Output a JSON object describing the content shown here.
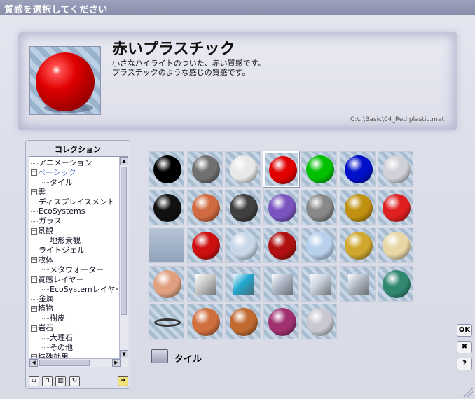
{
  "window": {
    "title": "質感を選択してください"
  },
  "material": {
    "name": "赤いプラスチック",
    "description_line1": "小さなハイライトのついた、赤い質感です。",
    "description_line2": "プラスチックのような感じの質感です。",
    "path": "C:\\..\\Basic\\04_Red plastic.mat"
  },
  "collection": {
    "title": "コレクション",
    "items": [
      {
        "label": "アニメーション",
        "expander": "",
        "indent": false
      },
      {
        "label": "ベーシック",
        "expander": "−",
        "indent": false,
        "selected": true
      },
      {
        "label": "タイル",
        "expander": "",
        "indent": true
      },
      {
        "label": "雲",
        "expander": "+",
        "indent": false
      },
      {
        "label": "ディスプレイスメント",
        "expander": "",
        "indent": false
      },
      {
        "label": "EcoSystems",
        "expander": "",
        "indent": false
      },
      {
        "label": "ガラス",
        "expander": "",
        "indent": false
      },
      {
        "label": "景観",
        "expander": "−",
        "indent": false
      },
      {
        "label": "地形景観",
        "expander": "",
        "indent": true
      },
      {
        "label": "ライトジェル",
        "expander": "",
        "indent": false
      },
      {
        "label": "液体",
        "expander": "−",
        "indent": false
      },
      {
        "label": "メタウォーター",
        "expander": "",
        "indent": true
      },
      {
        "label": "質感レイヤー",
        "expander": "−",
        "indent": false
      },
      {
        "label": "EcoSystemレイヤー",
        "expander": "",
        "indent": true
      },
      {
        "label": "金属",
        "expander": "",
        "indent": false
      },
      {
        "label": "植物",
        "expander": "−",
        "indent": false
      },
      {
        "label": "樹皮",
        "expander": "",
        "indent": true
      },
      {
        "label": "岩石",
        "expander": "−",
        "indent": false
      },
      {
        "label": "大理石",
        "expander": "",
        "indent": true
      },
      {
        "label": "その他",
        "expander": "",
        "indent": true
      },
      {
        "label": "特殊効果",
        "expander": "−",
        "indent": false
      }
    ],
    "tools": {
      "new_icon": "new-page-icon",
      "lock_icon": "lock-icon",
      "trash_icon": "trash-icon",
      "refresh_icon": "refresh-icon",
      "go_icon": "arrow-right-icon"
    }
  },
  "thumbnails": [
    {
      "kind": "sphere",
      "color": "#000000"
    },
    {
      "kind": "sphere",
      "color": "#707070"
    },
    {
      "kind": "sphere",
      "color": "#e8e8e8"
    },
    {
      "kind": "sphere",
      "color": "#e00000",
      "selected": true
    },
    {
      "kind": "sphere",
      "color": "#00c000"
    },
    {
      "kind": "sphere",
      "color": "#0010c8"
    },
    {
      "kind": "sphere",
      "color": "#d0d0d8"
    },
    {
      "kind": "sphere",
      "color": "#111111"
    },
    {
      "kind": "sphere",
      "color": "#d06a40"
    },
    {
      "kind": "sphere",
      "color": "#404040"
    },
    {
      "kind": "sphere",
      "color": "#7a55c0"
    },
    {
      "kind": "sphere",
      "color": "#888888"
    },
    {
      "kind": "sphere",
      "color": "#c09010"
    },
    {
      "kind": "sphere",
      "color": "#e02020"
    },
    {
      "kind": "plane",
      "color": "#b8c4d6"
    },
    {
      "kind": "sphere",
      "color": "#cc1010"
    },
    {
      "kind": "sphere",
      "color": "#c8d8e8"
    },
    {
      "kind": "sphere",
      "color": "#b01010"
    },
    {
      "kind": "sphere",
      "color": "#b8d0ec"
    },
    {
      "kind": "sphere",
      "color": "#d0a830"
    },
    {
      "kind": "sphere",
      "color": "#e8d8a8"
    },
    {
      "kind": "sphere",
      "color": "#e0a080"
    },
    {
      "kind": "cube",
      "color": "#c8c8c8"
    },
    {
      "kind": "cube",
      "color": "#20a8d0"
    },
    {
      "kind": "cube",
      "color": "#b0b8c8"
    },
    {
      "kind": "cube",
      "color": "#c8d0dc"
    },
    {
      "kind": "cube",
      "color": "#b0b8c4"
    },
    {
      "kind": "sphere",
      "color": "#308870"
    },
    {
      "kind": "ring",
      "color": "#333333"
    },
    {
      "kind": "sphere",
      "color": "#d07040"
    },
    {
      "kind": "sphere",
      "color": "#c06a30"
    },
    {
      "kind": "sphere",
      "color": "#a03070"
    },
    {
      "kind": "sphere",
      "color": "#c8c8d0"
    }
  ],
  "folder": {
    "label": "タイル",
    "icon": "folder-icon"
  },
  "buttons": {
    "ok": "OK",
    "close": "✖",
    "help": "?"
  }
}
